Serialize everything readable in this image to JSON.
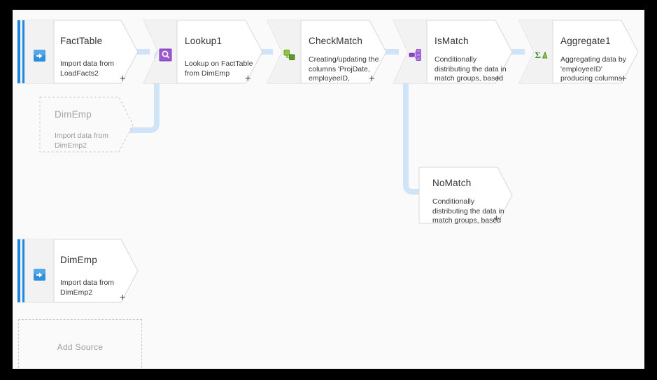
{
  "canvas": {
    "background_color": "#fafafa",
    "frame_color": "#000000",
    "connector_color": "#cfe4f7",
    "source_accent_color": "#1f86e0"
  },
  "nodes": [
    {
      "id": "factTable",
      "title": "FactTable",
      "description": "Import data from\nLoadFacts2",
      "kind": "source",
      "icon": "import-source-icon",
      "icon_color": "#2f8fd8",
      "plus": "+"
    },
    {
      "id": "dimEmpGhost",
      "title": "DimEmp",
      "description": "Import data from\nDimEmp2",
      "kind": "ghost-source",
      "icon": "none",
      "icon_color": "#c9c9c9",
      "plus": ""
    },
    {
      "id": "lookup1",
      "title": "Lookup1",
      "description": "Lookup on FactTable\nfrom DimEmp",
      "kind": "transform",
      "icon": "lookup-magnifier-icon",
      "icon_color": "#9b59d0",
      "plus": "+"
    },
    {
      "id": "checkMatch",
      "title": "CheckMatch",
      "description": "Creating/updating the\ncolumns 'ProjDate,\nemployeeID,",
      "kind": "transform",
      "icon": "derived-column-icon",
      "icon_color": "#6cb33f",
      "plus": "+"
    },
    {
      "id": "isMatch",
      "title": "IsMatch",
      "description": "Conditionally\ndistributing the data in\nmatch groups, based",
      "kind": "transform",
      "icon": "conditional-split-icon",
      "icon_color": "#8e44c8",
      "plus": "+"
    },
    {
      "id": "aggregate1",
      "title": "Aggregate1",
      "description": "Aggregating data by\n'employeeID'\nproducing columns",
      "kind": "transform",
      "icon": "aggregate-sigma-icon",
      "icon_color": "#3aa03a",
      "plus": "+"
    },
    {
      "id": "noMatch",
      "title": "NoMatch",
      "description": "Conditionally\ndistributing the data in\nmatch groups, based",
      "kind": "plain",
      "icon": "none",
      "icon_color": "#ffffff",
      "plus": "+"
    },
    {
      "id": "dimEmpSource",
      "title": "DimEmp",
      "description": "Import data from\nDimEmp2",
      "kind": "source",
      "icon": "import-source-icon",
      "icon_color": "#2f8fd8",
      "plus": "+"
    }
  ],
  "add_source": {
    "label": "Add Source"
  }
}
